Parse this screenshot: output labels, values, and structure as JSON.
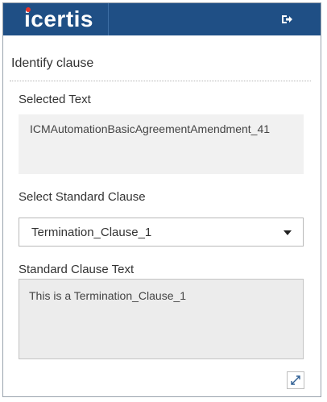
{
  "header": {
    "brand": "icertis",
    "brand_accent": "#e7332a",
    "bar_color": "#1f4f85",
    "logout_icon": "sign-out-icon"
  },
  "panel": {
    "title": "Identify clause",
    "selected_text_label": "Selected Text",
    "selected_text_value": "ICMAutomationBasicAgreementAmendment_41",
    "select_clause_label": "Select Standard Clause",
    "select_clause_value": "Termination_Clause_1",
    "clause_text_label": "Standard Clause Text",
    "clause_text_value": "This is a Termination_Clause_1",
    "expand_icon": "expand-icon"
  }
}
